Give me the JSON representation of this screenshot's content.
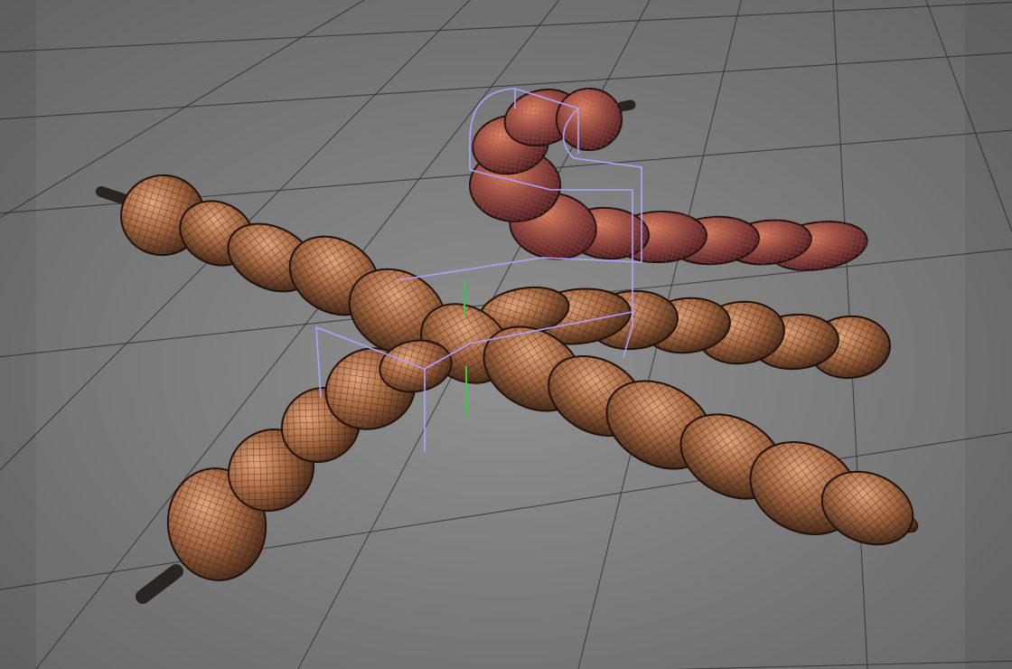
{
  "viewport": {
    "view": "perspective-3d",
    "background_color": "#7a7a7a",
    "grid_color": "#2a2a2a",
    "grid_visible": true
  },
  "scene": {
    "objects": [
      {
        "name": "pod-long-diagonal",
        "material_color": "#a86a43",
        "wireframe": true,
        "selected": false
      },
      {
        "name": "pod-lower-left",
        "material_color": "#a86a43",
        "wireframe": true,
        "selected": false
      },
      {
        "name": "pod-middle-right",
        "material_color": "#a86a43",
        "wireframe": true,
        "selected": false
      },
      {
        "name": "pod-curled-back",
        "material_color": "#a86a43",
        "wireframe": true,
        "selected": true,
        "selection_color": "#b04070"
      }
    ],
    "deformer_cage_color": "#a9a0ff",
    "axis_gizmo_color": "#2ecc40"
  }
}
